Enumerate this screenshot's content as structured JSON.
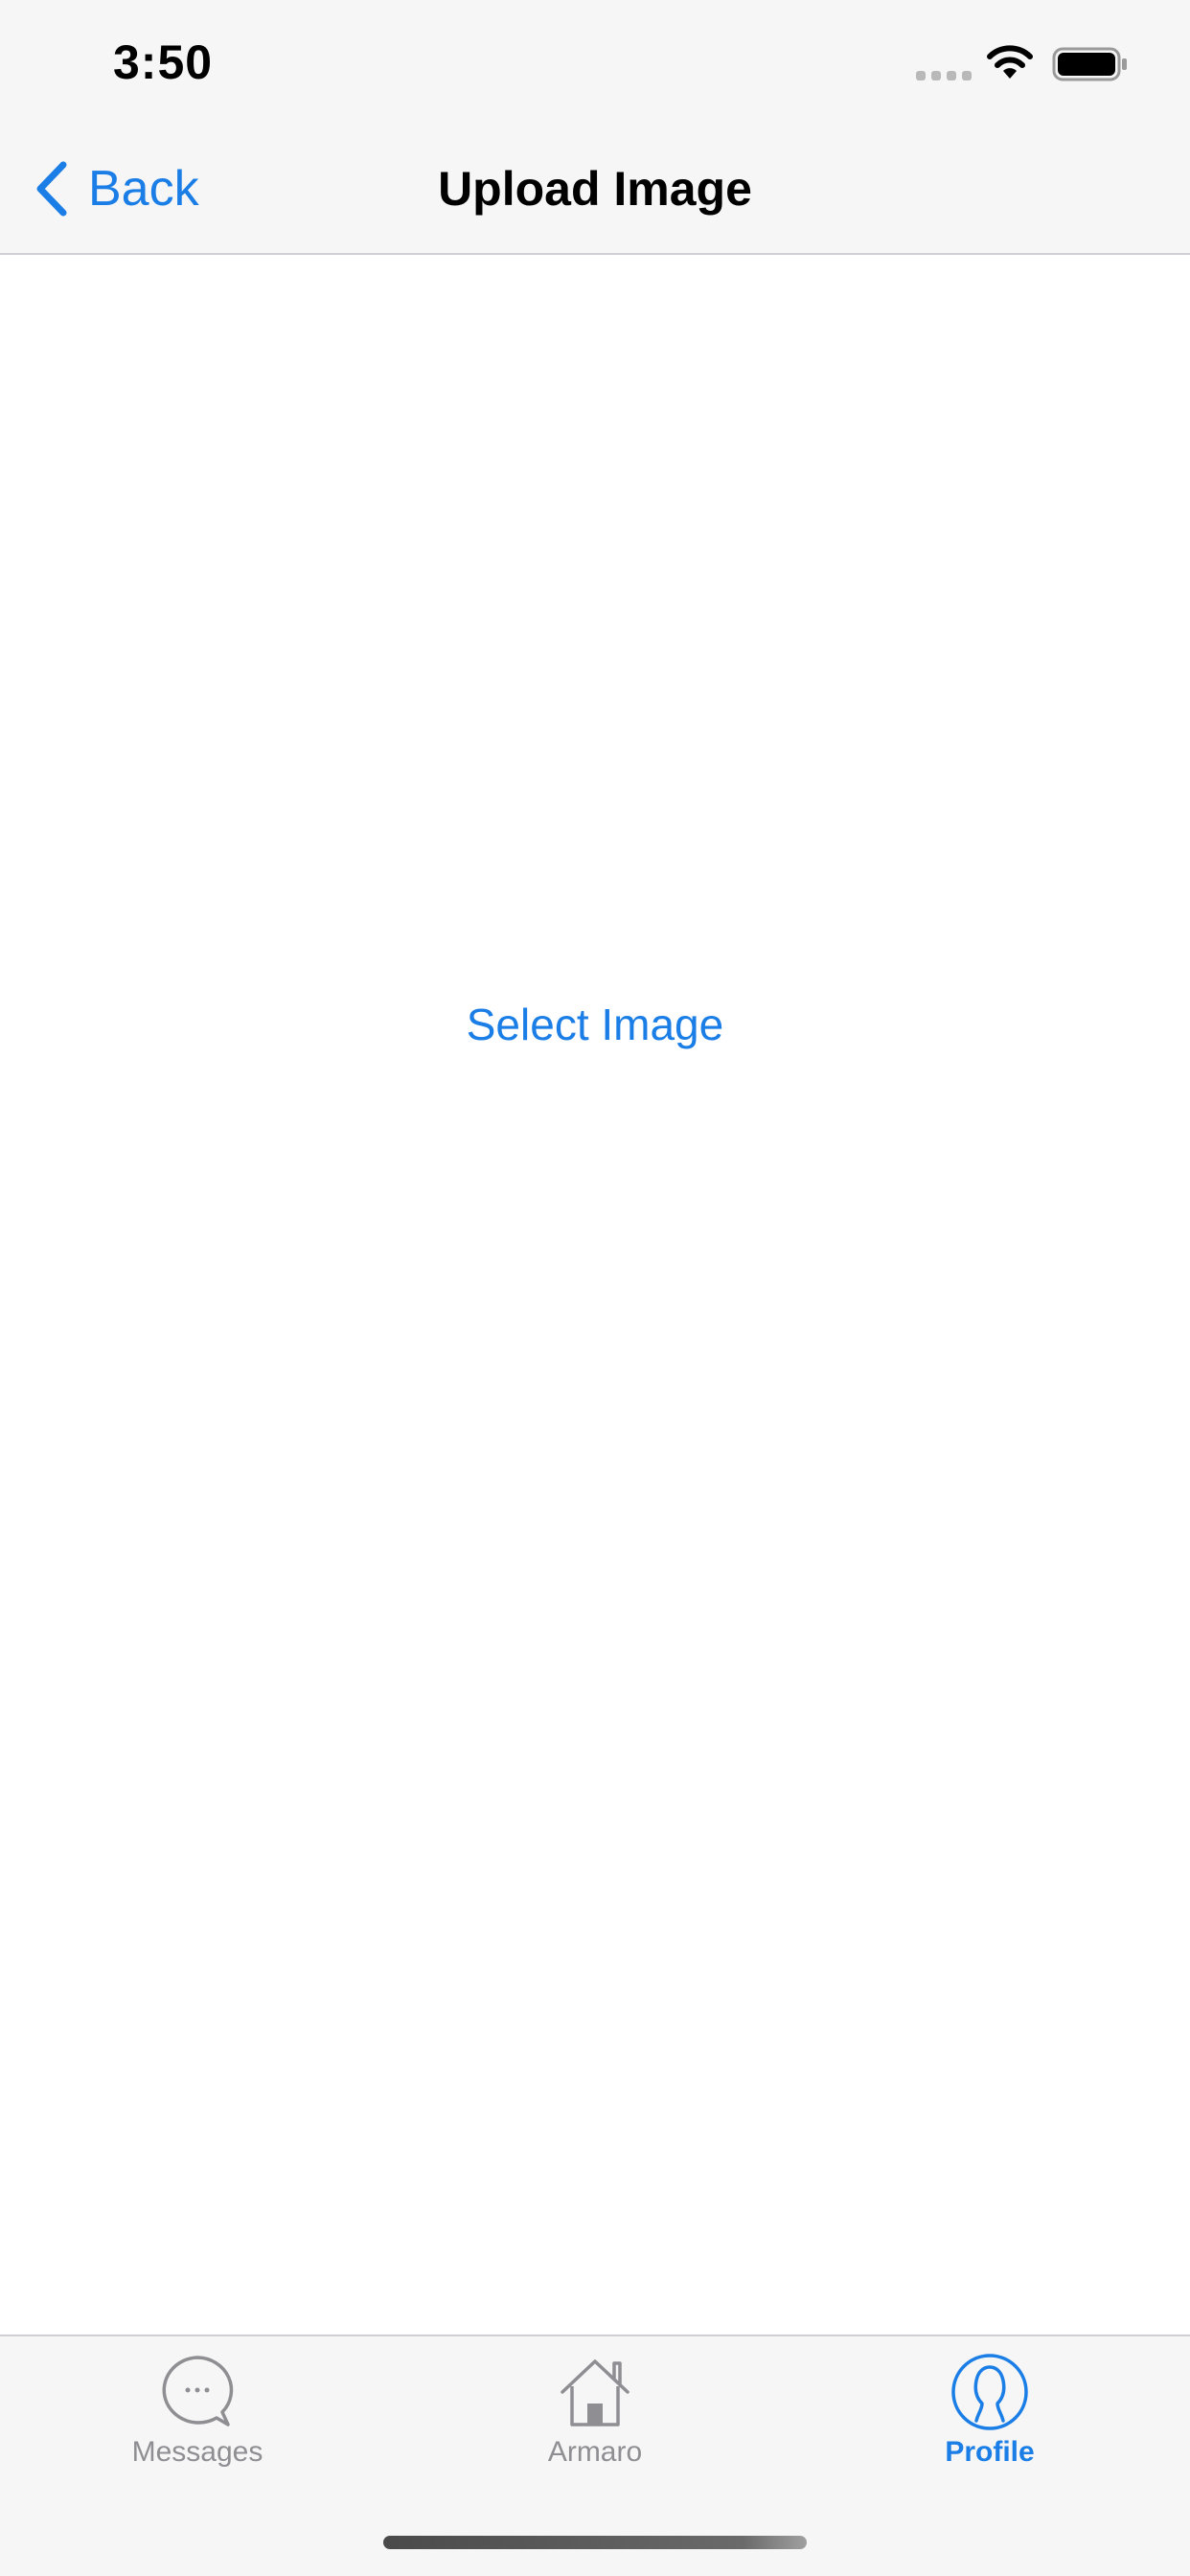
{
  "status_bar": {
    "time": "3:50",
    "icons": [
      "signal-dots-icon",
      "wifi-icon",
      "battery-icon"
    ]
  },
  "nav_bar": {
    "back_label": "Back",
    "title": "Upload Image"
  },
  "content": {
    "select_image_label": "Select Image"
  },
  "tab_bar": {
    "tabs": [
      {
        "label": "Messages",
        "icon": "chat-bubble-icon",
        "active": false
      },
      {
        "label": "Armaro",
        "icon": "home-icon",
        "active": false
      },
      {
        "label": "Profile",
        "icon": "profile-icon",
        "active": true
      }
    ]
  },
  "colors": {
    "accent": "#1a7ee6",
    "inactive": "#8e8e93",
    "bar_background": "#f6f6f6"
  }
}
